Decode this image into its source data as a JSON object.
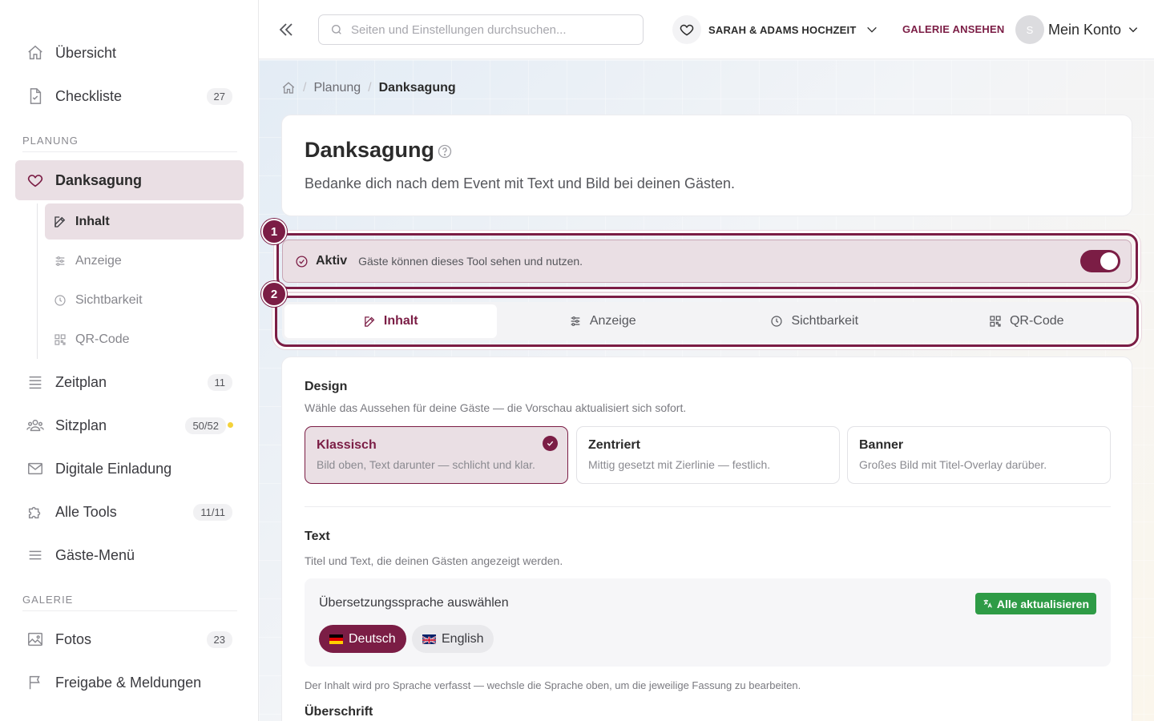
{
  "sidebar": {
    "top_items": [
      {
        "label": "Übersicht",
        "icon": "home-icon"
      },
      {
        "label": "Checkliste",
        "icon": "document-check-icon",
        "badge": "27"
      }
    ],
    "section_planung": "PLANUNG",
    "active_item": {
      "label": "Danksagung",
      "icon": "heart-icon"
    },
    "sub_items": [
      {
        "label": "Inhalt",
        "icon": "edit-icon"
      },
      {
        "label": "Anzeige",
        "icon": "sliders-icon"
      },
      {
        "label": "Sichtbarkeit",
        "icon": "clock-icon"
      },
      {
        "label": "QR-Code",
        "icon": "qr-code-icon"
      }
    ],
    "planung_items": [
      {
        "label": "Zeitplan",
        "icon": "list-icon",
        "badge": "11"
      },
      {
        "label": "Sitzplan",
        "icon": "users-icon",
        "badge": "50/52"
      },
      {
        "label": "Digitale Einladung",
        "icon": "mail-icon"
      },
      {
        "label": "Alle Tools",
        "icon": "puzzle-icon",
        "badge": "11/11"
      },
      {
        "label": "Gäste-Menü",
        "icon": "menu-icon"
      }
    ],
    "section_galerie": "GALERIE",
    "galerie_items": [
      {
        "label": "Fotos",
        "icon": "image-icon",
        "badge": "23"
      },
      {
        "label": "Freigabe & Meldungen",
        "icon": "flag-icon"
      }
    ]
  },
  "header": {
    "search_placeholder": "Seiten und Einstellungen durchsuchen...",
    "event_name": "SARAH & ADAMS HOCHZEIT",
    "gallery_link": "GALERIE ANSEHEN",
    "avatar_letter": "S",
    "account_label": "Mein Konto"
  },
  "breadcrumb": [
    "Planung",
    "Danksagung"
  ],
  "page": {
    "title": "Danksagung",
    "description": "Bedanke dich nach dem Event mit Text und Bild bei deinen Gästen."
  },
  "steps": [
    "1",
    "2"
  ],
  "active_status": {
    "label": "Aktiv",
    "description": "Gäste können dieses Tool sehen und nutzen.",
    "enabled": true
  },
  "tabs": [
    {
      "label": "Inhalt",
      "icon": "edit-icon"
    },
    {
      "label": "Anzeige",
      "icon": "sliders-icon"
    },
    {
      "label": "Sichtbarkeit",
      "icon": "clock-icon"
    },
    {
      "label": "QR-Code",
      "icon": "qr-code-icon"
    }
  ],
  "design": {
    "title": "Design",
    "subtitle": "Wähle das Aussehen für deine Gäste — die Vorschau aktualisiert sich sofort.",
    "options": [
      {
        "title": "Klassisch",
        "desc": "Bild oben, Text darunter — schlicht und klar.",
        "selected": true
      },
      {
        "title": "Zentriert",
        "desc": "Mittig gesetzt mit Zierlinie — festlich."
      },
      {
        "title": "Banner",
        "desc": "Großes Bild mit Titel-Overlay darüber."
      }
    ]
  },
  "text_section": {
    "title": "Text",
    "subtitle": "Titel und Text, die deinen Gästen angezeigt werden.",
    "lang_title": "Übersetzungssprache auswählen",
    "update_all": "Alle aktualisieren",
    "languages": [
      "Deutsch",
      "English"
    ],
    "note": "Der Inhalt wird pro Sprache verfasst — wechsle die Sprache oben, um die jeweilige Fassung zu bearbeiten.",
    "heading_label": "Überschrift"
  },
  "colors": {
    "accent": "#7b1d45",
    "accent_light": "#eadfe4",
    "success": "#2e9b46",
    "badge_dot": "#f4d23a"
  }
}
